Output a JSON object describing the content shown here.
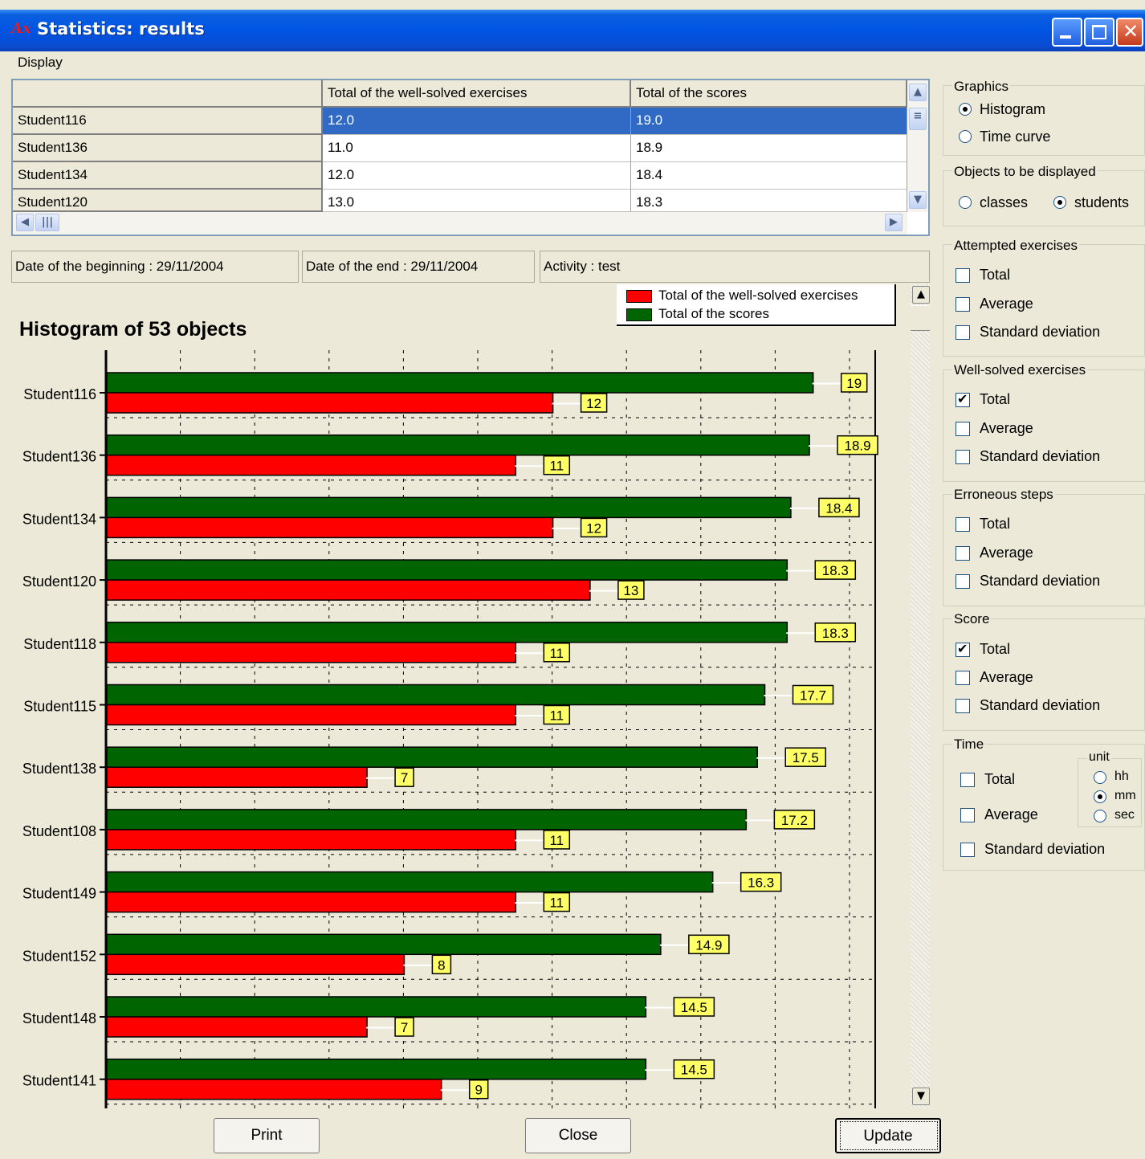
{
  "window": {
    "title": "Statistics: results",
    "icon": "app-logo-icon"
  },
  "menu": {
    "display": "Display"
  },
  "grid": {
    "headers": [
      "",
      "Total of the well-solved exercises",
      "Total of the scores"
    ],
    "rows": [
      [
        "Student116",
        "12.0",
        "19.0"
      ],
      [
        "Student136",
        "11.0",
        "18.9"
      ],
      [
        "Student134",
        "12.0",
        "18.4"
      ],
      [
        "Student120",
        "13.0",
        "18.3"
      ]
    ]
  },
  "info": {
    "begin": "Date of the beginning : 29/11/2004",
    "end": "Date of the end : 29/11/2004",
    "activity": "Activity : test"
  },
  "chart_data": {
    "type": "bar",
    "orientation": "horizontal",
    "title": "Histogram of 53 objects",
    "categories": [
      "Student116",
      "Student136",
      "Student134",
      "Student120",
      "Student118",
      "Student115",
      "Student138",
      "Student108",
      "Student149",
      "Student152",
      "Student148",
      "Student141"
    ],
    "series": [
      {
        "name": "Total of the well-solved exercises",
        "color": "#ff0000",
        "values": [
          12,
          11,
          12,
          13,
          11,
          11,
          7,
          11,
          11,
          8,
          7,
          9
        ],
        "labels": [
          "12",
          "11",
          "12",
          "13",
          "11",
          "11",
          "7",
          "11",
          "11",
          "8",
          "7",
          "9"
        ]
      },
      {
        "name": "Total of the scores",
        "color": "#006400",
        "values": [
          19,
          18.9,
          18.4,
          18.3,
          18.3,
          17.7,
          17.5,
          17.2,
          16.3,
          14.9,
          14.5,
          14.5
        ],
        "labels": [
          "19",
          "18.9",
          "18.4",
          "18.3",
          "18.3",
          "17.7",
          "17.5",
          "17.2",
          "16.3",
          "14.9",
          "14.5",
          "14.5"
        ]
      }
    ],
    "xlim": [
      0,
      20.7
    ],
    "grid": true,
    "legend": "top-right",
    "label_bg": "#ffff66"
  },
  "panel": {
    "graphics": {
      "title": "Graphics",
      "histogram": "Histogram",
      "time_curve": "Time curve"
    },
    "objects": {
      "title": "Objects to be displayed",
      "classes": "classes",
      "students": "students"
    },
    "attempted": {
      "title": "Attempted exercises",
      "total": "Total",
      "average": "Average",
      "std": "Standard deviation"
    },
    "wellsolved": {
      "title": "Well-solved exercises",
      "total": "Total",
      "average": "Average",
      "std": "Standard deviation"
    },
    "erroneous": {
      "title": "Erroneous steps",
      "total": "Total",
      "average": "Average",
      "std": "Standard deviation"
    },
    "score": {
      "title": "Score",
      "total": "Total",
      "average": "Average",
      "std": "Standard deviation"
    },
    "time": {
      "title": "Time",
      "total": "Total",
      "average": "Average",
      "std": "Standard deviation",
      "unit": "unit",
      "hh": "hh",
      "mm": "mm",
      "sec": "sec"
    }
  },
  "buttons": {
    "print": "Print",
    "close": "Close",
    "update": "Update"
  }
}
